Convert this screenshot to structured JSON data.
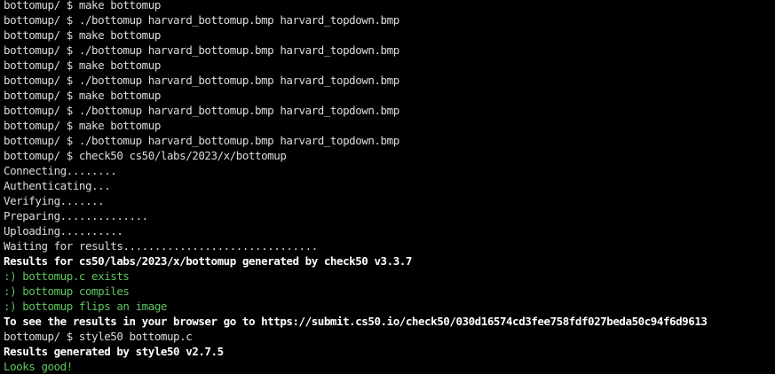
{
  "terminal": {
    "lines": [
      {
        "text": "bottomup/ $ make bottomup",
        "style": "normal"
      },
      {
        "text": "bottomup/ $ ./bottomup harvard_bottomup.bmp harvard_topdown.bmp",
        "style": "normal"
      },
      {
        "text": "bottomup/ $ make bottomup",
        "style": "normal"
      },
      {
        "text": "bottomup/ $ ./bottomup harvard_bottomup.bmp harvard_topdown.bmp",
        "style": "normal"
      },
      {
        "text": "bottomup/ $ make bottomup",
        "style": "normal"
      },
      {
        "text": "bottomup/ $ ./bottomup harvard_bottomup.bmp harvard_topdown.bmp",
        "style": "normal"
      },
      {
        "text": "bottomup/ $ make bottomup",
        "style": "normal"
      },
      {
        "text": "bottomup/ $ ./bottomup harvard_bottomup.bmp harvard_topdown.bmp",
        "style": "normal"
      },
      {
        "text": "bottomup/ $ make bottomup",
        "style": "normal"
      },
      {
        "text": "bottomup/ $ ./bottomup harvard_bottomup.bmp harvard_topdown.bmp",
        "style": "normal"
      },
      {
        "text": "bottomup/ $ check50 cs50/labs/2023/x/bottomup",
        "style": "normal"
      },
      {
        "text": "Connecting........",
        "style": "normal"
      },
      {
        "text": "Authenticating...",
        "style": "normal"
      },
      {
        "text": "Verifying.......",
        "style": "normal"
      },
      {
        "text": "Preparing..............",
        "style": "normal"
      },
      {
        "text": "Uploading..........",
        "style": "normal"
      },
      {
        "text": "Waiting for results...............................",
        "style": "normal"
      },
      {
        "text": "Results for cs50/labs/2023/x/bottomup generated by check50 v3.3.7",
        "style": "bold"
      },
      {
        "text": ":) bottomup.c exists",
        "style": "green"
      },
      {
        "text": ":) bottomup compiles",
        "style": "green"
      },
      {
        "text": ":) bottomup flips an image",
        "style": "green"
      },
      {
        "text": "To see the results in your browser go to https://submit.cs50.io/check50/030d16574cd3fee758fdf027beda50c94f6d9613",
        "style": "bold"
      },
      {
        "text": "bottomup/ $ style50 bottomup.c",
        "style": "normal"
      },
      {
        "text": "Results generated by style50 v2.7.5",
        "style": "bold"
      },
      {
        "text": "Looks good!",
        "style": "green"
      }
    ],
    "colors": {
      "background": "#000000",
      "text": "#dcdcdc",
      "bold": "#ffffff",
      "success": "#5fc45f"
    }
  }
}
